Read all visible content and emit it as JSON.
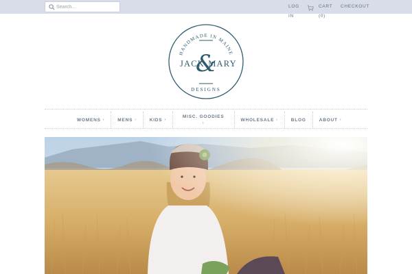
{
  "search": {
    "placeholder": "Search..."
  },
  "header": {
    "login_label": "Log in",
    "cart_label": "Cart (0)",
    "checkout_label": "Checkout"
  },
  "logo": {
    "top_text": "HANDMADE IN MAINE",
    "brand_left": "JACK",
    "brand_right": "MARY",
    "ampersand": "&",
    "bottom_text": "DESIGNS",
    "color": "#2f5b6e"
  },
  "nav": {
    "items": [
      {
        "label": "Womens",
        "caret": "›"
      },
      {
        "label": "Mens",
        "caret": "›"
      },
      {
        "label": "Kids",
        "caret": "›"
      },
      {
        "label": "Misc. Goodies",
        "caret": "›"
      },
      {
        "label": "Wholesale",
        "caret": "›"
      },
      {
        "label": "Blog"
      },
      {
        "label": "About",
        "caret": "›"
      }
    ]
  },
  "hero": {
    "icon": "hero-photo"
  },
  "colors": {
    "topbar": "#d9dde9",
    "nav_text": "#6a7888",
    "brand": "#2f5b6e"
  }
}
